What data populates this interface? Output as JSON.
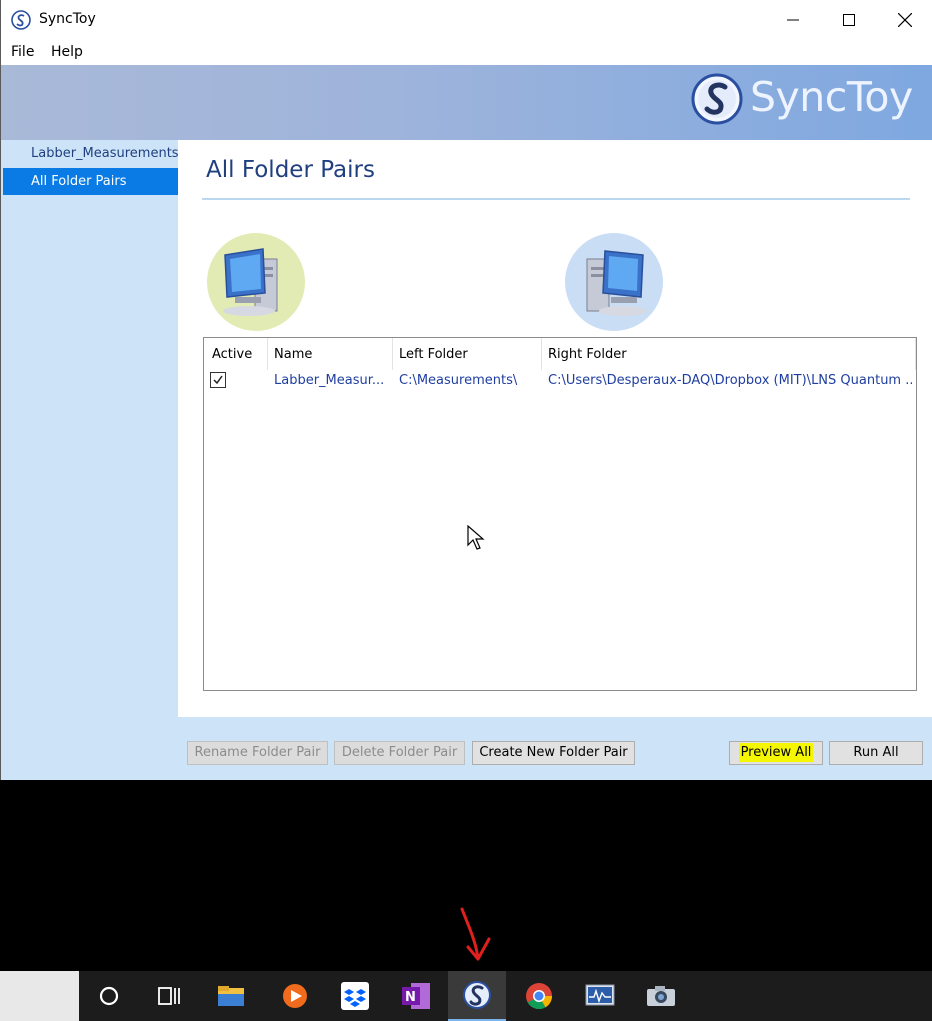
{
  "window": {
    "title": "SyncToy"
  },
  "menu": {
    "file": "File",
    "help": "Help"
  },
  "banner": {
    "logo_text": "SyncToy"
  },
  "sidebar": {
    "items": [
      {
        "label": "Labber_Measurements"
      },
      {
        "label": "All Folder Pairs"
      }
    ]
  },
  "main": {
    "title": "All Folder Pairs",
    "columns": [
      "Active",
      "Name",
      "Left Folder",
      "Right Folder"
    ],
    "rows": [
      {
        "active": true,
        "name": "Labber_Measur...",
        "left_folder": "C:\\Measurements\\",
        "right_folder": "C:\\Users\\Desperaux-DAQ\\Dropbox (MIT)\\LNS Quantum ..."
      }
    ]
  },
  "buttons": {
    "rename": "Rename Folder Pair",
    "delete": "Delete Folder Pair",
    "create": "Create New Folder Pair",
    "preview": "Preview All",
    "run": "Run All"
  },
  "colors": {
    "accent": "#0a7be4",
    "sidebar_bg": "#cde4f8",
    "title_text": "#1f3f7f",
    "highlight": "#f5f700",
    "annotation_arrow": "#e0201c"
  },
  "taskbar": {
    "icons": [
      "cortana-icon",
      "task-view-icon",
      "file-explorer-icon",
      "media-player-icon",
      "dropbox-icon",
      "onenote-icon",
      "synctoy-icon",
      "chrome-icon",
      "resource-monitor-icon",
      "camera-icon"
    ]
  }
}
